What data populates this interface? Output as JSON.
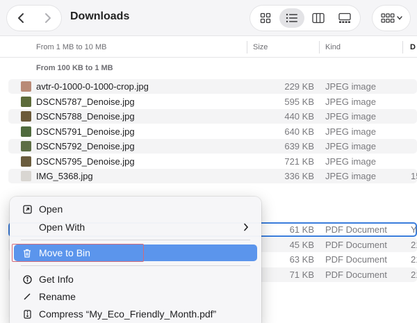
{
  "toolbar": {
    "title": "Downloads",
    "back_icon": "chevron-left-icon",
    "forward_icon": "chevron-right-icon",
    "views": [
      "icon-view",
      "list-view",
      "column-view",
      "gallery-view"
    ],
    "active_view": "list-view",
    "group_icon": "group-by-icon"
  },
  "columns": {
    "name": "From 1 MB to 10 MB",
    "size": "Size",
    "kind": "Kind",
    "date": "D"
  },
  "section_label": "From 100 KB to 1 MB",
  "files": [
    {
      "name": "avtr-0-1000-0-1000-crop.jpg",
      "size": "229 KB",
      "kind": "JPEG image",
      "date": "",
      "thumb": "#b98a76"
    },
    {
      "name": "DSCN5787_Denoise.jpg",
      "size": "595 KB",
      "kind": "JPEG image",
      "date": "",
      "thumb": "#5c6b3a"
    },
    {
      "name": "DSCN5788_Denoise.jpg",
      "size": "440 KB",
      "kind": "JPEG image",
      "date": "",
      "thumb": "#6b5a3a"
    },
    {
      "name": "DSCN5791_Denoise.jpg",
      "size": "640 KB",
      "kind": "JPEG image",
      "date": "",
      "thumb": "#4f6a3d"
    },
    {
      "name": "DSCN5792_Denoise.jpg",
      "size": "639 KB",
      "kind": "JPEG image",
      "date": "",
      "thumb": "#5d6e44"
    },
    {
      "name": "DSCN5795_Denoise.jpg",
      "size": "721 KB",
      "kind": "JPEG image",
      "date": "",
      "thumb": "#6a5c3d"
    },
    {
      "name": "IMG_5368.jpg",
      "size": "336 KB",
      "kind": "JPEG image",
      "date": "15",
      "thumb": "#d9d6d2"
    }
  ],
  "pdf_rows": [
    {
      "size": "61 KB",
      "kind": "PDF Document",
      "date": "Ye"
    },
    {
      "size": "45 KB",
      "kind": "PDF Document",
      "date": "21"
    },
    {
      "size": "63 KB",
      "kind": "PDF Document",
      "date": "21"
    },
    {
      "size": "71 KB",
      "kind": "PDF Document",
      "date": "21"
    }
  ],
  "context_menu": {
    "open": "Open",
    "open_with": "Open With",
    "move_to_bin": "Move to Bin",
    "get_info": "Get Info",
    "rename": "Rename",
    "compress": "Compress “My_Eco_Friendly_Month.pdf”"
  },
  "colors": {
    "highlight": "#5b95ec",
    "selection_border": "#3a7ddc",
    "annotation_box": "#d26a7a"
  }
}
